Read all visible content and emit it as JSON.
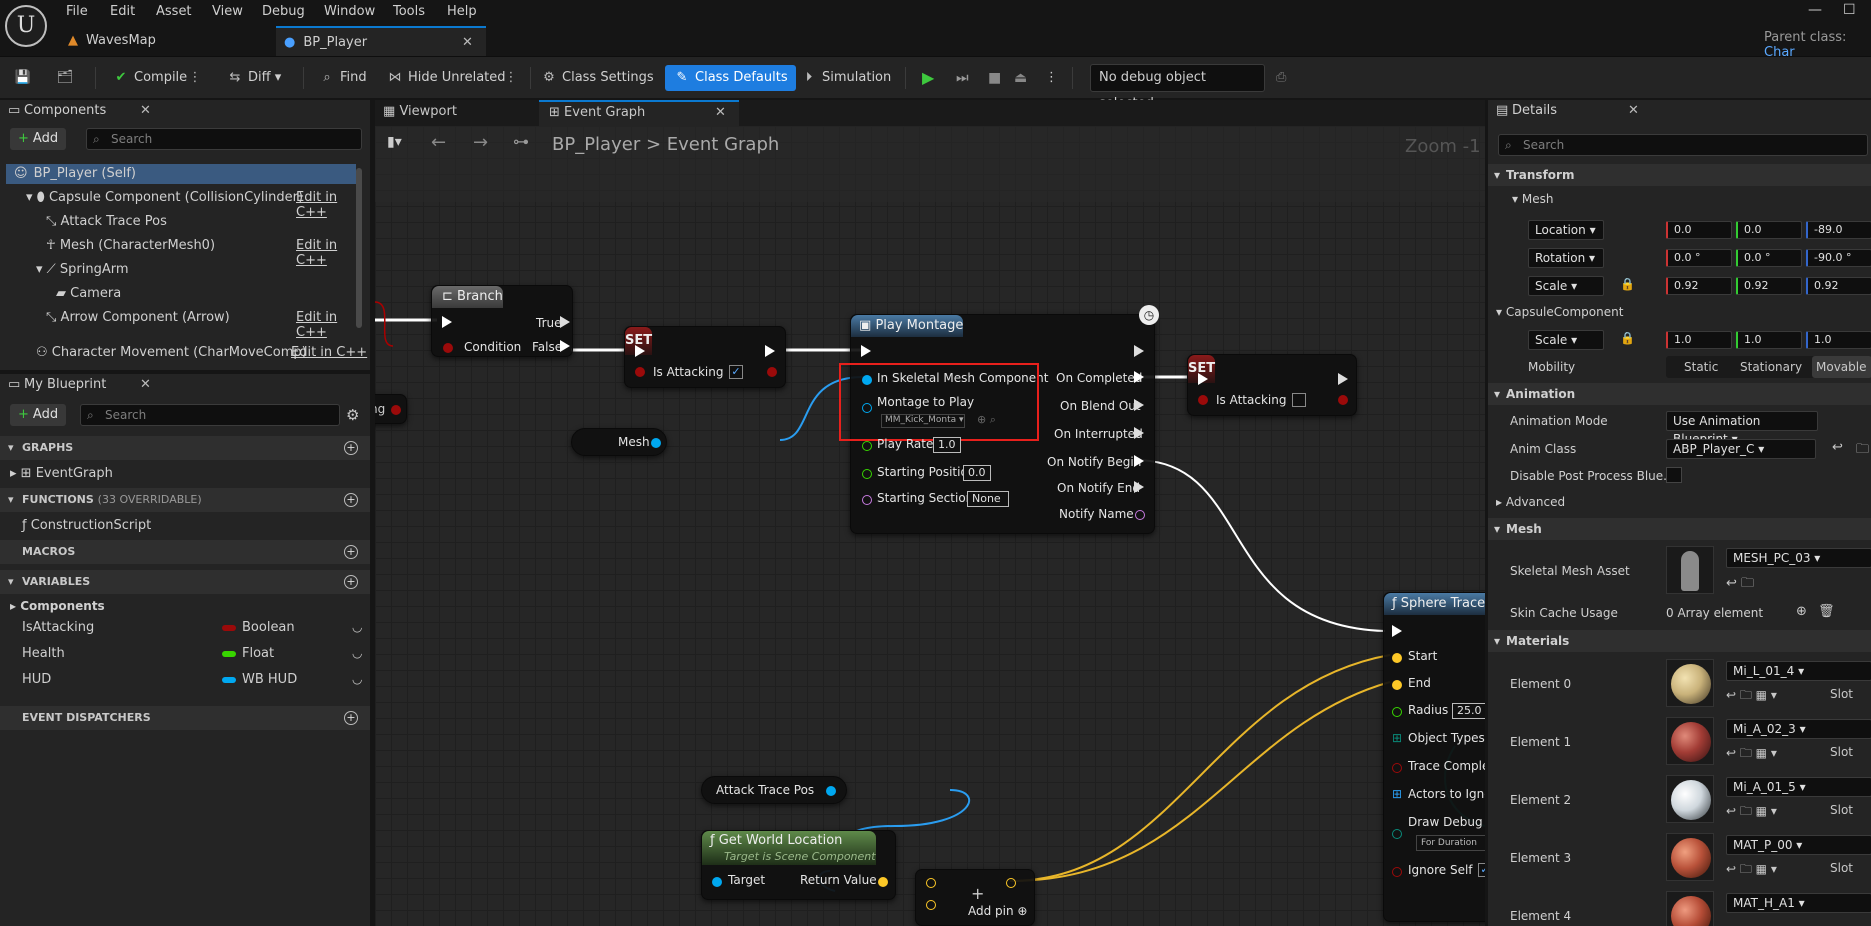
{
  "app": {
    "logo_glyph": "U"
  },
  "menu": [
    "File",
    "Edit",
    "Asset",
    "View",
    "Debug",
    "Window",
    "Tools",
    "Help"
  ],
  "doc_tabs": [
    {
      "label": "WavesMap",
      "active": false
    },
    {
      "label": "BP_Player",
      "active": true
    }
  ],
  "parent_class": "Parent class:",
  "parent_class_value": "Char",
  "toolbar": {
    "compile": "Compile",
    "diff": "Diff",
    "find": "Find",
    "hide_unrelated": "Hide Unrelated",
    "class_settings": "Class Settings",
    "class_defaults": "Class Defaults",
    "simulation": "Simulation",
    "debug_object": "No debug object selected"
  },
  "components_panel": {
    "title": "Components",
    "add": "Add",
    "search_placeholder": "Search",
    "items": [
      {
        "label": "BP_Player (Self)",
        "edit": ""
      },
      {
        "label": "Capsule Component (CollisionCylinder)",
        "edit": "Edit in C++"
      },
      {
        "label": "Attack Trace Pos",
        "edit": ""
      },
      {
        "label": "Mesh (CharacterMesh0)",
        "edit": "Edit in C++"
      },
      {
        "label": "SpringArm",
        "edit": ""
      },
      {
        "label": "Camera",
        "edit": ""
      },
      {
        "label": "Arrow Component (Arrow)",
        "edit": "Edit in C++"
      },
      {
        "label": "Character Movement (CharMoveComp)",
        "edit": "Edit in C++"
      }
    ]
  },
  "my_blueprint": {
    "title": "My Blueprint",
    "add": "Add",
    "search_placeholder": "Search",
    "graphs": "GRAPHS",
    "event_graph": "EventGraph",
    "functions": "FUNCTIONS",
    "functions_note": "(33 OVERRIDABLE)",
    "construction": "ConstructionScript",
    "macros": "MACROS",
    "variables": "VARIABLES",
    "components_cat": "Components",
    "vars": [
      {
        "name": "IsAttacking",
        "type": "Boolean",
        "color": "#9b0a0a"
      },
      {
        "name": "Health",
        "type": "Float",
        "color": "#38d500"
      },
      {
        "name": "HUD",
        "type": "WB HUD",
        "color": "#00a8f0"
      }
    ],
    "dispatchers": "EVENT DISPATCHERS"
  },
  "graph_tabs": {
    "viewport": "Viewport",
    "event_graph": "Event Graph"
  },
  "breadcrumb": {
    "root": "BP_Player",
    "sep": ">",
    "current": "Event Graph",
    "zoom": "Zoom -1"
  },
  "nodes": {
    "branch": {
      "title": "Branch",
      "true": "True",
      "false": "False",
      "condition": "Condition"
    },
    "set1": {
      "title": "SET",
      "pin": "Is Attacking"
    },
    "set2": {
      "title": "SET",
      "pin": "Is Attacking"
    },
    "left_stub": "ng",
    "mesh": "Mesh",
    "play_montage": {
      "title": "Play Montage",
      "in_skeletal": "In Skeletal Mesh Component",
      "montage": "Montage to Play",
      "montage_value": "MM_Kick_Monta",
      "play_rate": "Play Rate",
      "play_rate_val": "1.0",
      "start_pos": "Starting Position",
      "start_pos_val": "0.0",
      "start_sec": "Starting Section",
      "start_sec_val": "None",
      "on_completed": "On Completed",
      "on_blend_out": "On Blend Out",
      "on_interrupted": "On Interrupted",
      "on_notify_begin": "On Notify Begin",
      "on_notify_end": "On Notify End",
      "notify_name": "Notify Name"
    },
    "sphere_trace": {
      "title": "Sphere Trace F",
      "start": "Start",
      "end": "End",
      "radius": "Radius",
      "radius_val": "25.0",
      "object_types": "Object Types",
      "trace_complex": "Trace Complex",
      "actors_ignore": "Actors to Ignore",
      "draw_debug": "Draw Debug Ty",
      "draw_debug_val": "For Duration",
      "ignore_self": "Ignore Self"
    },
    "attack_trace_pos": "Attack Trace Pos",
    "get_world_location": {
      "title": "Get World Location",
      "subtitle": "Target is Scene Component",
      "target": "Target",
      "return": "Return Value"
    },
    "add_pin": "Add pin"
  },
  "details": {
    "title": "Details",
    "search_placeholder": "Search",
    "transform": "Transform",
    "mesh_cat": "Mesh",
    "location": "Location",
    "location_vals": [
      "0.0",
      "0.0",
      "-89.0"
    ],
    "rotation": "Rotation",
    "rotation_vals": [
      "0.0 °",
      "0.0 °",
      "-90.0 °"
    ],
    "scale": "Scale",
    "scale_vals": [
      "0.92",
      "0.92",
      "0.92"
    ],
    "capsule": "CapsuleComponent",
    "capsule_scale_vals": [
      "1.0",
      "1.0",
      "1.0"
    ],
    "mobility": "Mobility",
    "mob_static": "Static",
    "mob_stationary": "Stationary",
    "mob_movable": "Movable",
    "animation": "Animation",
    "anim_mode": "Animation Mode",
    "anim_mode_val": "Use Animation Blueprint",
    "anim_class": "Anim Class",
    "anim_class_val": "ABP_Player_C",
    "disable_pp": "Disable Post Process Blue...",
    "advanced": "Advanced",
    "mesh2": "Mesh",
    "skel_asset": "Skeletal Mesh Asset",
    "skel_asset_val": "MESH_PC_03",
    "skin_cache": "Skin Cache Usage",
    "skin_cache_val": "0 Array element",
    "materials": "Materials",
    "slot": "Slot",
    "elements": [
      {
        "label": "Element 0",
        "mat": "Mi_L_01_4",
        "color": "#c9b27a"
      },
      {
        "label": "Element 1",
        "mat": "Mi_A_02_3",
        "color": "#a23c35"
      },
      {
        "label": "Element 2",
        "mat": "Mi_A_01_5",
        "color": "#cfd7dd"
      },
      {
        "label": "Element 3",
        "mat": "MAT_P_00",
        "color": "#b9523a"
      },
      {
        "label": "Element 4",
        "mat": "MAT_H_A1",
        "color": "#b64d37"
      }
    ]
  },
  "colors": {
    "accent": "#1e7de0",
    "exec": "#ffffff",
    "object_pin": "#00a8f0",
    "bool_pin": "#9b0a0a",
    "float_pin": "#38d500",
    "vector_pin": "#fdc827",
    "name_pin": "#c77be0"
  }
}
